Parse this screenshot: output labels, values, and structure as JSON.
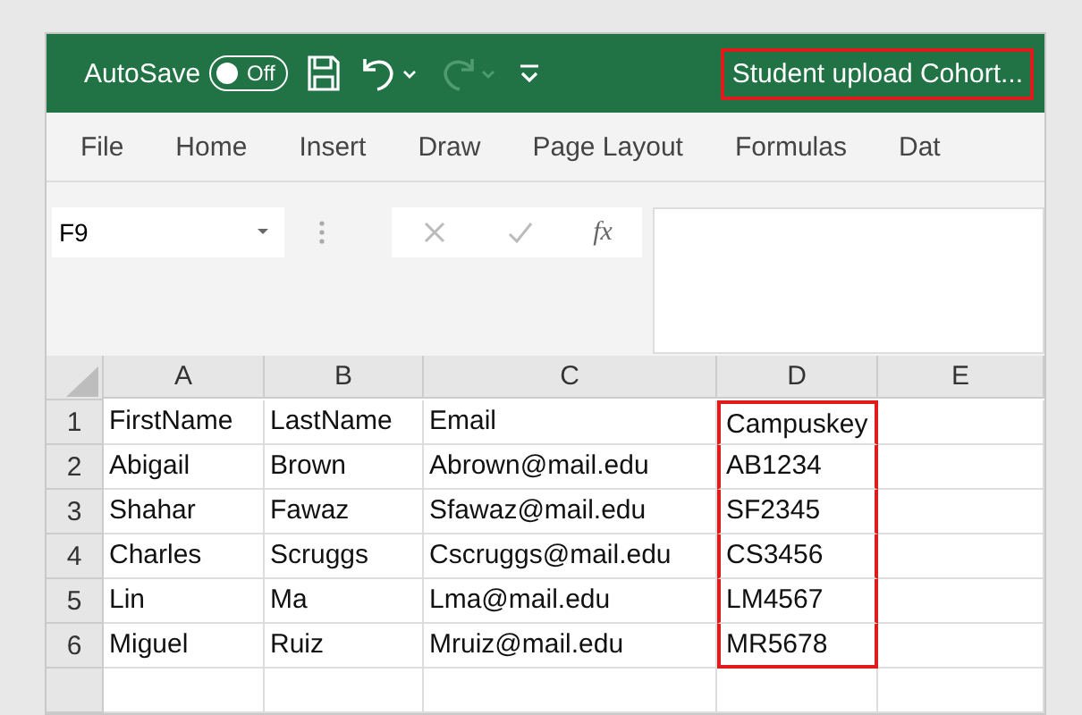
{
  "title_bar": {
    "autosave_label": "AutoSave",
    "autosave": {
      "on": false,
      "label": "Off"
    },
    "quick_access": [
      {
        "kind": "save",
        "disabled": false
      },
      {
        "kind": "undo",
        "disabled": false
      },
      {
        "kind": "redo",
        "disabled": true
      },
      {
        "kind": "customize",
        "disabled": false
      }
    ],
    "title": "Student upload Cohort...",
    "title_highlighted": true
  },
  "ribbon_tabs": [
    {
      "label": "File"
    },
    {
      "label": "Home"
    },
    {
      "label": "Insert"
    },
    {
      "label": "Draw"
    },
    {
      "label": "Page Layout"
    },
    {
      "label": "Formulas"
    },
    {
      "label": "Dat"
    }
  ],
  "formula_bar": {
    "name_box": "F9",
    "fx_label": "fx"
  },
  "sheet": {
    "columns": [
      {
        "label": "A",
        "highlighted": false
      },
      {
        "label": "B",
        "highlighted": false
      },
      {
        "label": "C",
        "highlighted": false
      },
      {
        "label": "D",
        "highlighted": true
      },
      {
        "label": "E",
        "highlighted": false
      }
    ],
    "rows": [
      {
        "number": "1",
        "cells": [
          "FirstName",
          "LastName",
          "Email",
          "Campuskey"
        ]
      },
      {
        "number": "2",
        "cells": [
          "Abigail",
          "Brown",
          "Abrown@mail.edu",
          "AB1234"
        ]
      },
      {
        "number": "3",
        "cells": [
          "Shahar",
          "Fawaz",
          "Sfawaz@mail.edu",
          "SF2345"
        ]
      },
      {
        "number": "4",
        "cells": [
          "Charles",
          "Scruggs",
          "Cscruggs@mail.edu",
          "CS3456"
        ]
      },
      {
        "number": "5",
        "cells": [
          "Lin",
          "Ma",
          "Lma@mail.edu",
          "LM4567"
        ]
      },
      {
        "number": "6",
        "cells": [
          "Miguel",
          "Ruiz",
          "Mruiz@mail.edu",
          "MR5678"
        ]
      }
    ]
  }
}
